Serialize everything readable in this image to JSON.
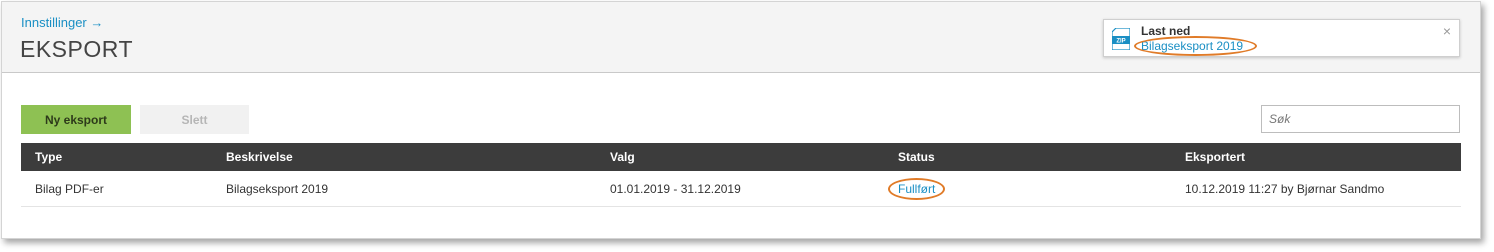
{
  "header": {
    "breadcrumb": "Innstillinger →",
    "title": "EKSPORT"
  },
  "notification": {
    "icon": "zip-file-icon",
    "icon_text": "ZIP",
    "title": "Last ned",
    "link": "Bilagseksport 2019",
    "close": "×"
  },
  "toolbar": {
    "new_label": "Ny eksport",
    "delete_label": "Slett",
    "search_placeholder": "Søk"
  },
  "table": {
    "columns": [
      "Type",
      "Beskrivelse",
      "Valg",
      "Status",
      "Eksportert"
    ],
    "rows": [
      {
        "type": "Bilag PDF-er",
        "description": "Bilagseksport 2019",
        "selection": "01.01.2019 - 31.12.2019",
        "status": "Fullført",
        "exported": "10.12.2019 11:27 by Bjørnar Sandmo"
      }
    ]
  },
  "colors": {
    "accent_link": "#1a8fc4",
    "primary_button": "#8ec153",
    "table_header": "#3c3c3c",
    "annotation": "#e07b28"
  }
}
